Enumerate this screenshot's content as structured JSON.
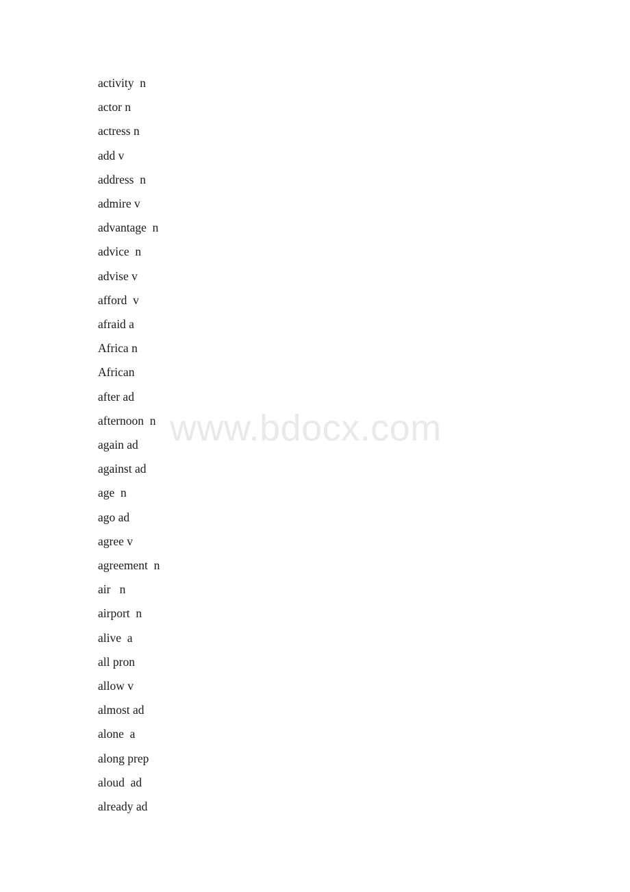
{
  "document": {
    "page_background": "#ffffff",
    "text_color": "#1a1a1a"
  },
  "watermark": {
    "text": "www.bdocx.com",
    "color": "#e9e9e9"
  },
  "word_list": {
    "entries": [
      {
        "text": "activity  n"
      },
      {
        "text": "actor n"
      },
      {
        "text": "actress n"
      },
      {
        "text": "add v"
      },
      {
        "text": "address  n"
      },
      {
        "text": "admire v"
      },
      {
        "text": "advantage  n"
      },
      {
        "text": "advice  n"
      },
      {
        "text": "advise v"
      },
      {
        "text": "afford  v"
      },
      {
        "text": "afraid a"
      },
      {
        "text": "Africa n"
      },
      {
        "text": "African"
      },
      {
        "text": "after ad"
      },
      {
        "text": "afternoon  n"
      },
      {
        "text": "again ad"
      },
      {
        "text": "against ad"
      },
      {
        "text": "age  n"
      },
      {
        "text": "ago ad"
      },
      {
        "text": "agree v"
      },
      {
        "text": "agreement  n"
      },
      {
        "text": "air   n"
      },
      {
        "text": "airport  n"
      },
      {
        "text": "alive  a"
      },
      {
        "text": "all pron"
      },
      {
        "text": "allow v"
      },
      {
        "text": "almost ad"
      },
      {
        "text": "alone  a"
      },
      {
        "text": "along prep"
      },
      {
        "text": "aloud  ad"
      },
      {
        "text": "already ad"
      }
    ]
  }
}
